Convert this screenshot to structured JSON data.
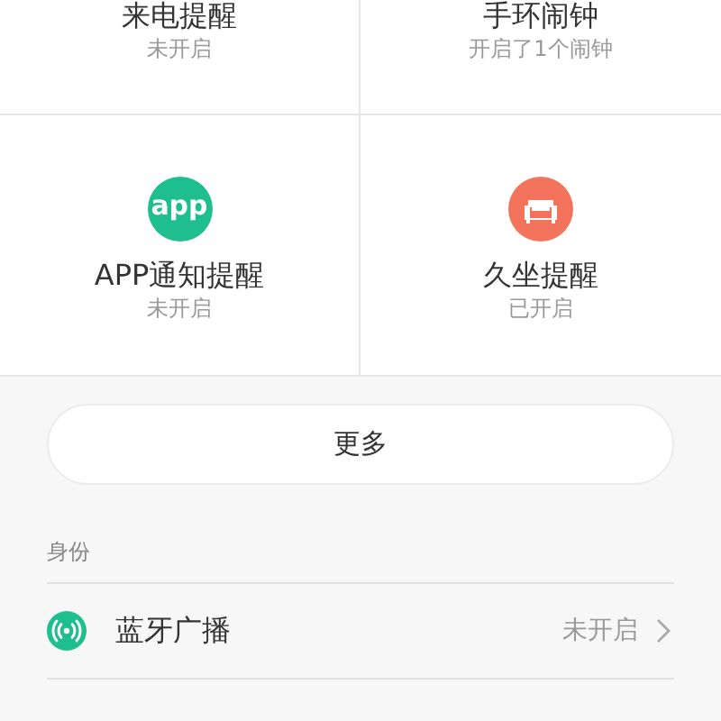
{
  "reminders": [
    {
      "title": "来电提醒",
      "status": "未开启"
    },
    {
      "title": "手环闹钟",
      "status": "开启了1个闹钟"
    },
    {
      "title": "APP通知提醒",
      "status": "未开启",
      "icon": {
        "kind": "text",
        "text": "app",
        "color": "#1fbe8e"
      }
    },
    {
      "title": "久坐提醒",
      "status": "已开启",
      "icon": {
        "kind": "sofa",
        "color": "#f3735c"
      }
    }
  ],
  "more_button": "更多",
  "section": {
    "title": "身份",
    "items": [
      {
        "label": "蓝牙广播",
        "value": "未开启",
        "icon": {
          "kind": "broadcast",
          "color": "#1fbe8e"
        }
      }
    ]
  }
}
